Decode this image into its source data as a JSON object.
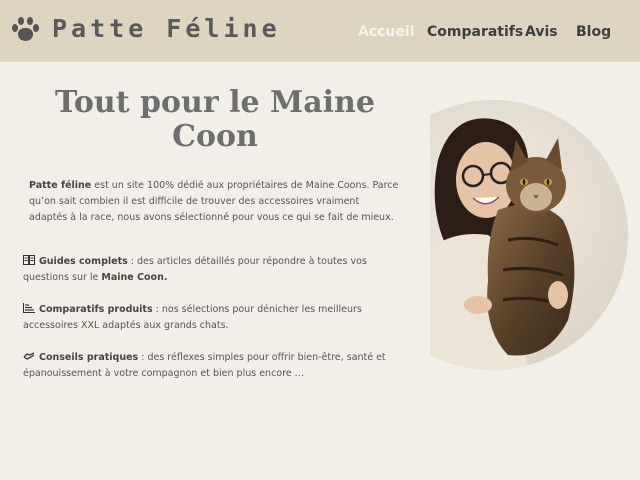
{
  "header": {
    "brand": "Patte Féline",
    "nav": [
      {
        "label": "Accueil",
        "active": true
      },
      {
        "label": "Comparatifs",
        "active": false
      },
      {
        "label": "Avis",
        "active": false
      },
      {
        "label": "Blog",
        "active": false
      }
    ]
  },
  "hero": {
    "title": "Tout pour le Maine Coon",
    "intro_strong": "Patte féline",
    "intro_text": " est un site 100% dédié aux propriétaires de Maine Coons. Parce qu’on sait combien il est difficile de trouver des accessoires vraiment adaptés à la race, nous avons sélectionné pour vous ce qui se fait de mieux."
  },
  "features": [
    {
      "icon": "book-icon",
      "title": "Guides complets",
      "text": " : des articles détaillés pour répondre à toutes vos questions sur le ",
      "trailing_strong": "Maine Coon."
    },
    {
      "icon": "chart-bars-icon",
      "title": "Comparatifs produits",
      "text": " : nos sélections pour dénicher les meilleurs accessoires XXL adaptés aux grands chats.",
      "trailing_strong": ""
    },
    {
      "icon": "handshake-icon",
      "title": "Conseils pratiques",
      "text": " : des réflexes simples pour offrir bien-être, santé et épanouissement à votre compagnon et bien plus encore …",
      "trailing_strong": ""
    }
  ],
  "colors": {
    "header_bg": "#ddd5c0",
    "page_bg": "#f2efe8",
    "active_nav": "#f6f3ea",
    "title": "#6e6e6e"
  }
}
